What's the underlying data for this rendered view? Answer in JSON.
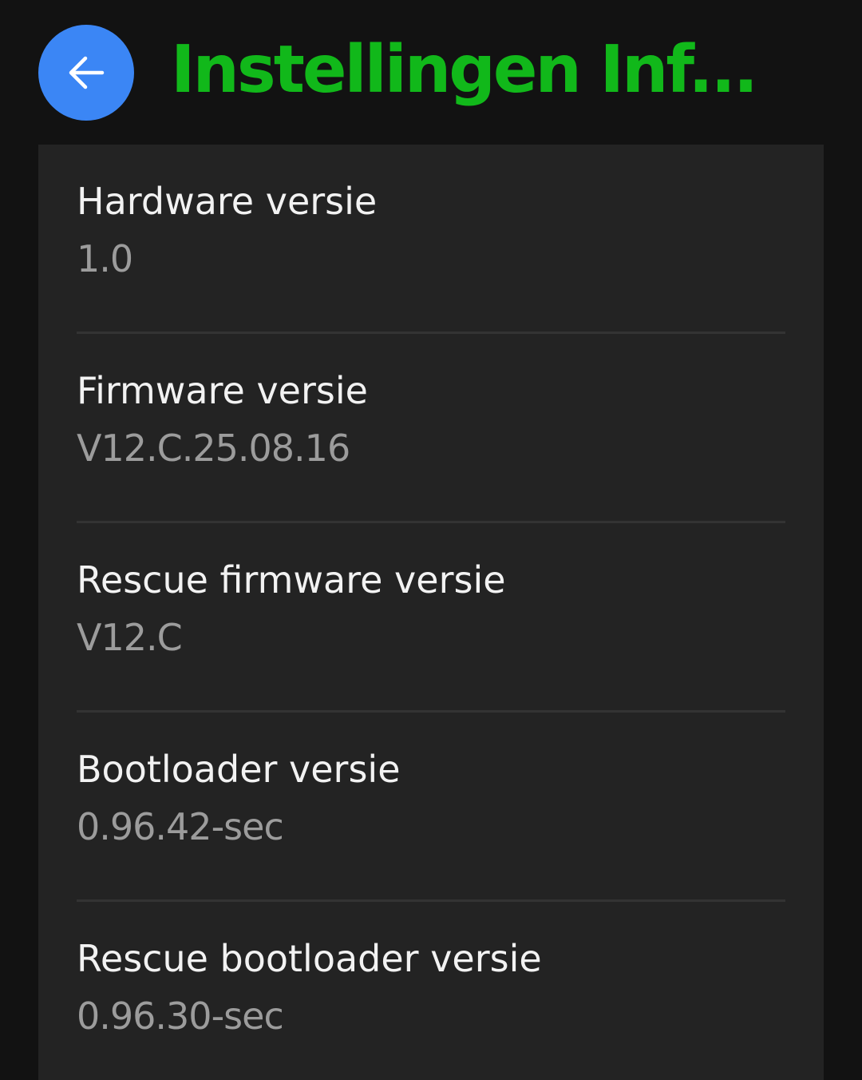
{
  "header": {
    "title": "Instellingen Inf...",
    "back_icon": "arrow-left-icon"
  },
  "colors": {
    "back_button": "#3b86f5",
    "title": "#11b81a",
    "background": "#121212",
    "card": "#232323"
  },
  "info": {
    "items": [
      {
        "label": "Hardware versie",
        "value": "1.0"
      },
      {
        "label": "Firmware versie",
        "value": "V12.C.25.08.16"
      },
      {
        "label": "Rescue firmware versie",
        "value": "V12.C"
      },
      {
        "label": "Bootloader versie",
        "value": "0.96.42-sec"
      },
      {
        "label": "Rescue bootloader versie",
        "value": "0.96.30-sec"
      }
    ]
  }
}
